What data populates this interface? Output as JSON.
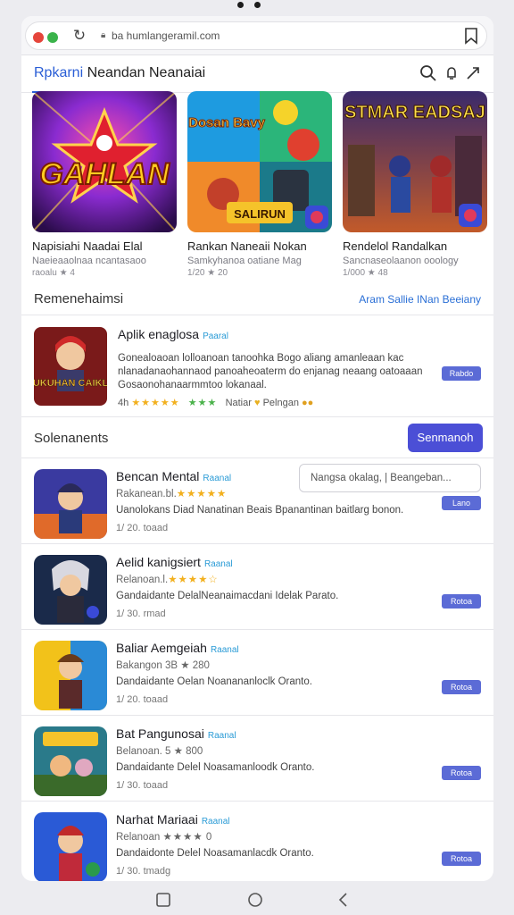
{
  "browser": {
    "url": "ba humlangeramil.com"
  },
  "header": {
    "title_accent": "Rpkarni",
    "title_rest": "Neandan Neanaiai"
  },
  "featured": [
    {
      "art_text": "GAHLAN",
      "title": "Napisiahi Naadai Elal",
      "subtitle": "Naeieaaolnaa ncantasaoo",
      "meta": "raoalu ★ 4"
    },
    {
      "art_text": "SALIRUN",
      "top_text": "Dosan Bavy",
      "title": "Rankan Naneaii Nokan",
      "subtitle": "Samkyhanoa oatiane Mag",
      "meta": "1/20 ★ 20"
    },
    {
      "art_text": "STMAR EADSAJ",
      "title": "Rendelol Randalkan",
      "subtitle": "Sancnaseolaanon ooology",
      "meta": "1/000 ★ 48"
    }
  ],
  "recommended": {
    "section_title": "Remenehaimsi",
    "section_link": "Aram Sallie INan Beeiany",
    "app": {
      "art_text": "SUKUHAN CAIKLS",
      "name": "Aplik enaglosa",
      "badge": "Paaral",
      "description": "Gonealoaoan lolloanoan tanoohka Bogo aliang amanleaan kac nlanadanaohannaod panoaheoaterm do enjanag neaang oatoaaan Gosaonohanaarmmtoo lokanaal.",
      "rating_count": "4h",
      "stars": "★★★★★",
      "stars2": "★★★",
      "tag1": "Natiar",
      "tag2": "Pelngan",
      "action": "Rabdo"
    }
  },
  "solenanents": {
    "section_title": "Solenanents",
    "button": "Senmanoh",
    "search_placeholder": "Nangsa okalag,  |  Beangeban...",
    "items": [
      {
        "name": "Bencan Mental",
        "badge": "Raanal",
        "sub": "Rakanean.bl.",
        "stars": "★★★★★",
        "desc": "Uanolokans Diad Nanatinan Beais Bpanantinan baitlarg bonon.",
        "meta": "1/ 20.  toaad",
        "action": "Lano"
      },
      {
        "name": "Aelid kanigsiert",
        "badge": "Raanal",
        "sub": "Relanoan.l.",
        "stars": "★★★★☆",
        "desc": "Gandaidante DelalNeanaimacdani Idelak Parato.",
        "meta": "1/ 30.  rmad",
        "action": "Rotoa"
      },
      {
        "name": "Baliar Aemgeiah",
        "badge": "Raanal",
        "sub": "Bakangon 3B ★ 280",
        "stars": "",
        "desc": "Dandaidante Oelan Noanananloclk Oranto.",
        "meta": "1/ 20.  toaad",
        "action": "Rotoa"
      },
      {
        "name": "Bat Pangunosai",
        "badge": "Raanal",
        "sub": "Belanoan. 5 ★ 800",
        "stars": "",
        "desc": "Dandaidante Delel Noasamanloodk Oranto.",
        "meta": "1/ 30.  toaad",
        "action": "Rotoa"
      },
      {
        "name": "Narhat Mariaai",
        "badge": "Raanal",
        "sub": "Relanoan",
        "stars": "★★★★",
        "stars_tail": "0",
        "desc": "Dandaidonte Delel Noasamanlacdk Oranto.",
        "meta": "1/ 30.  tmadg",
        "action": "Rotoa"
      }
    ]
  },
  "colors": {
    "primary": "#4b4fd6",
    "accent_link": "#2a6fd6",
    "star": "#f2b01e"
  }
}
